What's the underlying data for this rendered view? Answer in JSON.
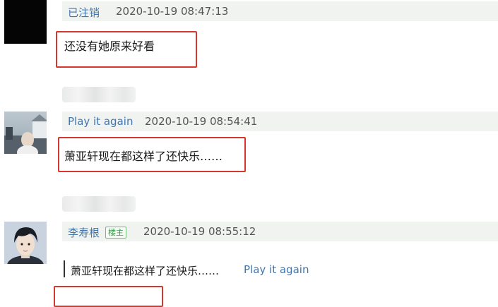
{
  "comments": [
    {
      "username": "已注销",
      "timestamp": "2020-10-19 08:47:13",
      "text": "还没有她原来好看"
    },
    {
      "username": "Play it again",
      "timestamp": "2020-10-19 08:54:41",
      "text": "萧亚轩现在都这样了还快乐……"
    },
    {
      "username": "李寿根",
      "badge": "楼主",
      "timestamp": "2020-10-19 08:55:12",
      "quote_text": "萧亚轩现在都这样了还快乐……",
      "quote_author": "Play it again"
    }
  ],
  "colors": {
    "username": "#3f75b0",
    "highlight_border": "#d6362b",
    "meta_bar_bg": "#f1f3f0",
    "badge_green": "#3b9a4d"
  }
}
